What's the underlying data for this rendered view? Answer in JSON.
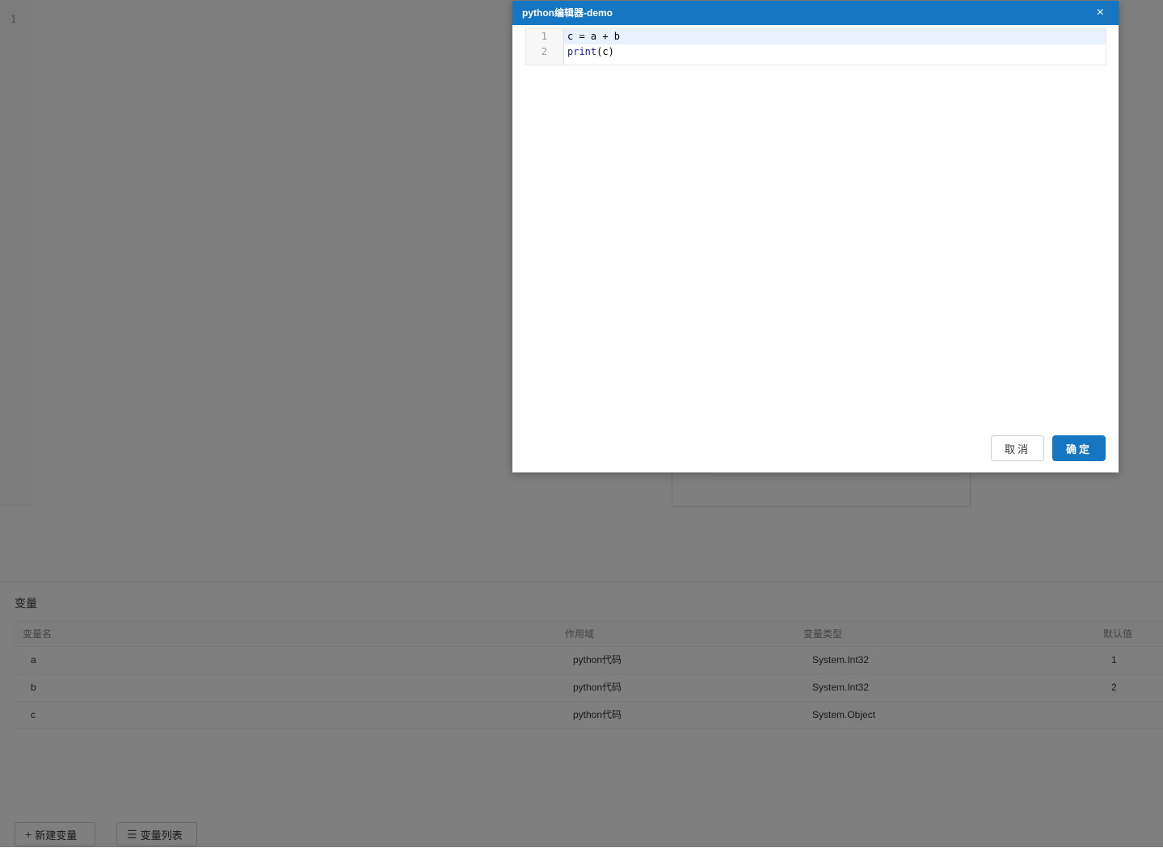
{
  "background_editor": {
    "line_number": "1"
  },
  "variables_panel": {
    "title": "变量",
    "columns": [
      "变量名",
      "作用域",
      "变量类型",
      "默认值"
    ],
    "rows": [
      {
        "name": "a",
        "scope": "python代码",
        "type": "System.Int32",
        "default": "1"
      },
      {
        "name": "b",
        "scope": "python代码",
        "type": "System.Int32",
        "default": "2"
      },
      {
        "name": "c",
        "scope": "python代码",
        "type": "System.Object",
        "default": ""
      }
    ],
    "new_button": {
      "icon": "+",
      "label": "新建变量"
    },
    "list_button": {
      "icon": "☰",
      "label": "变量列表"
    }
  },
  "modal": {
    "title": "python编辑器-demo",
    "close_icon": "×",
    "code_lines": [
      {
        "num": "1",
        "text": "c = a + b"
      },
      {
        "num": "2",
        "keyword": "print",
        "rest": "(c)"
      }
    ],
    "cancel_label": "取消",
    "ok_label": "确定"
  },
  "colors": {
    "primary": "#1676c2",
    "mask": "rgba(0,0,0,0.5)"
  }
}
